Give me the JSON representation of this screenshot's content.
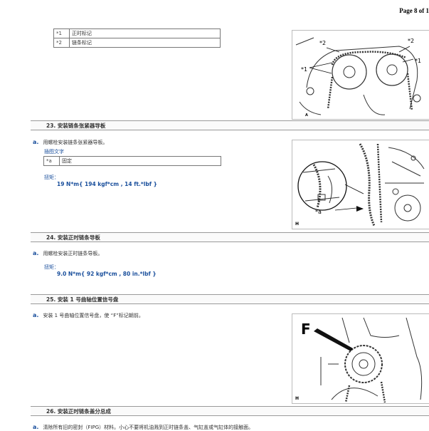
{
  "page_number": "Page 8 of 1",
  "legend_top": [
    {
      "key": "*1",
      "value": "正时标记"
    },
    {
      "key": "*2",
      "value": "链条标记"
    }
  ],
  "figure1": {
    "callouts": [
      "*2",
      "*2",
      "*1",
      "*1"
    ],
    "code": "A"
  },
  "step23": {
    "title": "23. 安装链条张紧器导板",
    "sub_a": {
      "letter": "a.",
      "text": "用螺栓安装链条张紧器导板。"
    },
    "caption": "插图文字",
    "legend": [
      {
        "key": "*a",
        "value": "固定"
      }
    ],
    "torque_label": "扭矩：",
    "torque_value": "19 N*m{ 194 kgf*cm , 14 ft.*lbf }",
    "figure": {
      "callout": "*a",
      "code": "H"
    }
  },
  "step24": {
    "title": "24. 安装正时链条导板",
    "sub_a": {
      "letter": "a.",
      "text": "用螺栓安装正时链条导板。"
    },
    "torque_label": "扭矩：",
    "torque_value": "9.0 N*m{ 92 kgf*cm , 80 in.*lbf }"
  },
  "step25": {
    "title": "25. 安装 1 号曲轴位置信号盘",
    "sub_a": {
      "letter": "a.",
      "text": "安装 1 号曲轴位置信号盘，使 “F”标记朝前。"
    },
    "figure": {
      "callout": "F",
      "code": "H"
    }
  },
  "step26": {
    "title": "26. 安装正时链条盖分总成",
    "sub_a": {
      "letter": "a.",
      "text": "清除所有旧的密封（FIPG）材料。小心不要将机油溅到正时链条盖、气缸盖或气缸体的接触面。"
    }
  }
}
